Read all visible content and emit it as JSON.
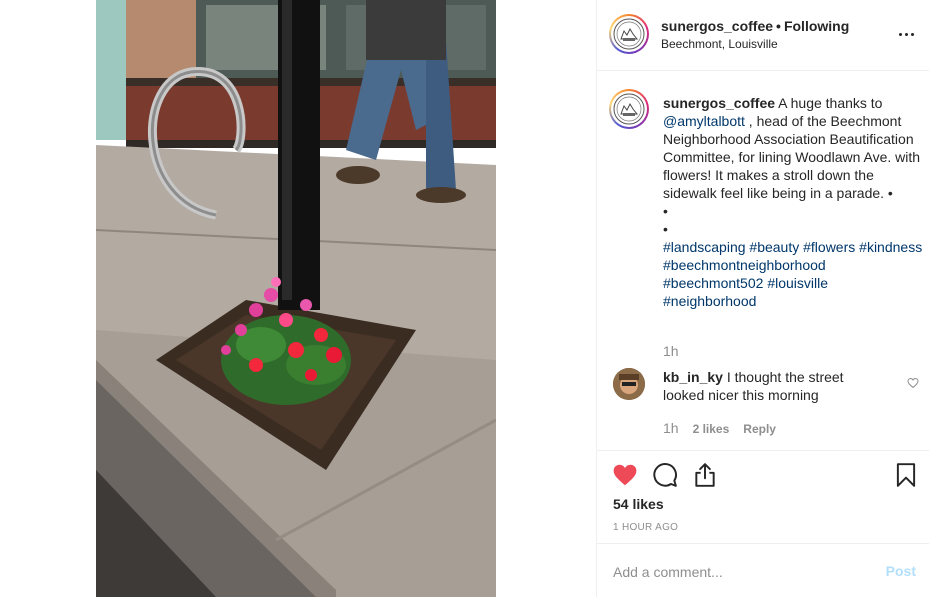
{
  "post": {
    "username": "sunergos_coffee",
    "separator": "•",
    "follow_status": "Following",
    "location": "Beechmont, Louisville",
    "more_icon": "more-horizontal-icon"
  },
  "caption": {
    "username": "sunergos_coffee",
    "text_before_mention": " A huge thanks to ",
    "mention": "@amyltalbott",
    "text_after_mention": " , head of the Beechmont Neighborhood Association Beautification Committee, for lining Woodlawn Ave. with flowers! It makes a stroll down the sidewalk feel like being in a parade. •",
    "bullet_line_1": "•",
    "bullet_line_2": "•",
    "hashtags": [
      "#landscaping",
      "#beauty",
      "#flowers",
      "#kindness",
      "#beechmontneighborhood",
      "#beechmont502",
      "#louisville",
      "#neighborhood"
    ],
    "time": "1h"
  },
  "comment": {
    "username": "kb_in_ky",
    "text": " I thought the street looked nicer this morning",
    "time": "1h",
    "likes": "2 likes",
    "reply": "Reply",
    "like_icon": "heart-outline-icon"
  },
  "actions": {
    "like_icon": "heart-filled-icon",
    "comment_icon": "comment-icon",
    "share_icon": "share-icon",
    "save_icon": "bookmark-icon",
    "like_color": "#ed4956",
    "likes_count": "54 likes",
    "posted": "1 HOUR AGO"
  },
  "composer": {
    "placeholder": "Add a comment...",
    "post_label": "Post",
    "post_color": "#b2dffc"
  },
  "colors": {
    "link": "#00376b",
    "secondary_text": "#8e8e8e",
    "border": "#efefef"
  }
}
